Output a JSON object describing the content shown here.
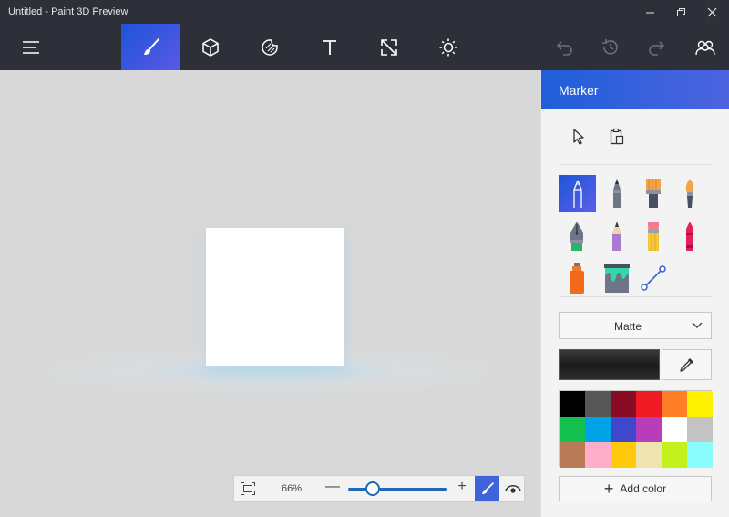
{
  "window": {
    "title": "Untitled - Paint 3D Preview"
  },
  "toolbar": {
    "items": [
      {
        "name": "menu-button",
        "icon": "hamburger-icon"
      },
      {
        "name": "tab-art-tools",
        "icon": "brush-icon",
        "active": true
      },
      {
        "name": "tab-3d-objects",
        "icon": "cube-icon"
      },
      {
        "name": "tab-stickers",
        "icon": "sticker-icon"
      },
      {
        "name": "tab-text",
        "icon": "text-icon"
      },
      {
        "name": "tab-canvas",
        "icon": "resize-icon"
      },
      {
        "name": "tab-effects",
        "icon": "sun-icon"
      },
      {
        "name": "undo-button",
        "icon": "undo-icon"
      },
      {
        "name": "history-button",
        "icon": "history-icon"
      },
      {
        "name": "redo-button",
        "icon": "redo-icon"
      },
      {
        "name": "community-button",
        "icon": "people-icon"
      }
    ],
    "accent": "#3f5fdc"
  },
  "panel": {
    "title": "Marker",
    "tools": [
      {
        "name": "marker",
        "icon": "marker-icon",
        "selected": true
      },
      {
        "name": "calligraphy-pen",
        "icon": "calligraphy-pen-icon"
      },
      {
        "name": "oil-brush",
        "icon": "oil-brush-icon"
      },
      {
        "name": "watercolor",
        "icon": "watercolor-icon"
      },
      {
        "name": "pixel-pen",
        "icon": "pen-nib-icon"
      },
      {
        "name": "pencil",
        "icon": "pencil-icon"
      },
      {
        "name": "eraser",
        "icon": "eraser-icon"
      },
      {
        "name": "crayon",
        "icon": "crayon-icon"
      },
      {
        "name": "spray-can",
        "icon": "spray-can-icon"
      },
      {
        "name": "fill",
        "icon": "paint-bucket-icon"
      },
      {
        "name": "line-curve",
        "icon": "line-icon"
      }
    ],
    "finish": "Matte",
    "current_color": "#222222",
    "palette": [
      "#000000",
      "#575757",
      "#8a0b24",
      "#ee1b24",
      "#ff7f27",
      "#fff200",
      "#14c14e",
      "#00a2e8",
      "#3f48cc",
      "#b83dba",
      "#ffffff",
      "#c3c3c3",
      "#b97a57",
      "#ffaec9",
      "#ffc90e",
      "#efe4b0",
      "#c4f01e",
      "#8bfcfc"
    ],
    "add_color_label": "Add color"
  },
  "zoom": {
    "percent_label": "66%",
    "minus": "—",
    "plus": "+",
    "level": 0.25
  }
}
